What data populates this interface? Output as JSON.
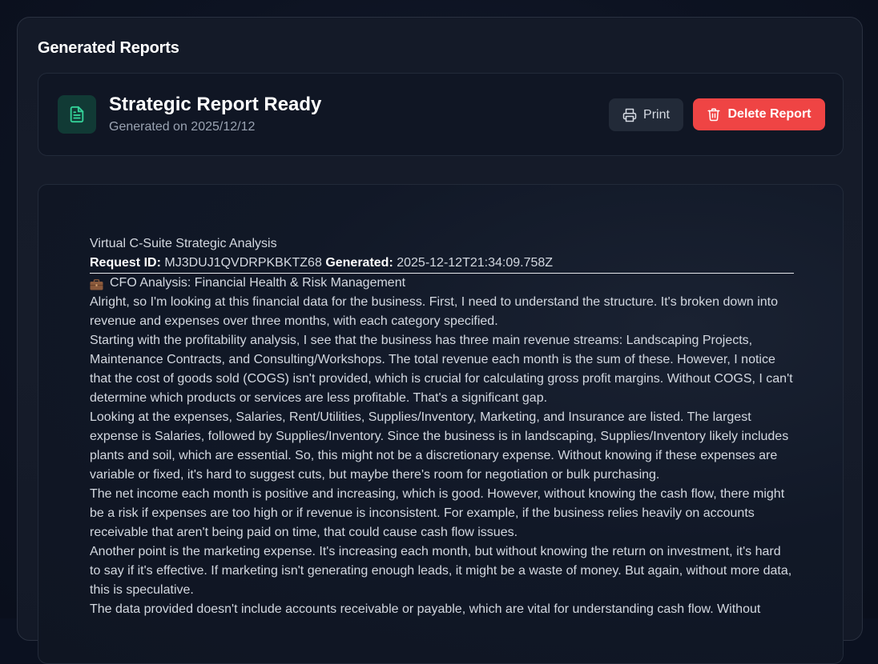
{
  "section": {
    "title": "Generated Reports"
  },
  "report_header": {
    "title": "Strategic Report Ready",
    "subtitle": "Generated on 2025/12/12",
    "print_label": "Print",
    "delete_label": "Delete Report"
  },
  "document": {
    "title": "Virtual C-Suite Strategic Analysis",
    "request_id_label": "Request ID:",
    "request_id_value": "MJ3DUJ1QVDRPKBKTZ68",
    "generated_label": "Generated:",
    "generated_value": "2025-12-12T21:34:09.758Z",
    "cfo_heading": "CFO Analysis: Financial Health & Risk Management",
    "paragraphs": [
      "Alright, so I'm looking at this financial data for the business. First, I need to understand the structure. It's broken down into revenue and expenses over three months, with each category specified.",
      "Starting with the profitability analysis, I see that the business has three main revenue streams: Landscaping Projects, Maintenance Contracts, and Consulting/Workshops. The total revenue each month is the sum of these. However, I notice that the cost of goods sold (COGS) isn't provided, which is crucial for calculating gross profit margins. Without COGS, I can't determine which products or services are less profitable. That's a significant gap.",
      "Looking at the expenses, Salaries, Rent/Utilities, Supplies/Inventory, Marketing, and Insurance are listed. The largest expense is Salaries, followed by Supplies/Inventory. Since the business is in landscaping, Supplies/Inventory likely includes plants and soil, which are essential. So, this might not be a discretionary expense. Without knowing if these expenses are variable or fixed, it's hard to suggest cuts, but maybe there's room for negotiation or bulk purchasing.",
      "The net income each month is positive and increasing, which is good. However, without knowing the cash flow, there might be a risk if expenses are too high or if revenue is inconsistent. For example, if the business relies heavily on accounts receivable that aren't being paid on time, that could cause cash flow issues.",
      "Another point is the marketing expense. It's increasing each month, but without knowing the return on investment, it's hard to say if it's effective. If marketing isn't generating enough leads, it might be a waste of money. But again, without more data, this is speculative.",
      "The data provided doesn't include accounts receivable or payable, which are vital for understanding cash flow. Without"
    ]
  },
  "colors": {
    "accent_green": "#10b981",
    "delete_red": "#ef4444",
    "page_bg": "#0b1120"
  }
}
